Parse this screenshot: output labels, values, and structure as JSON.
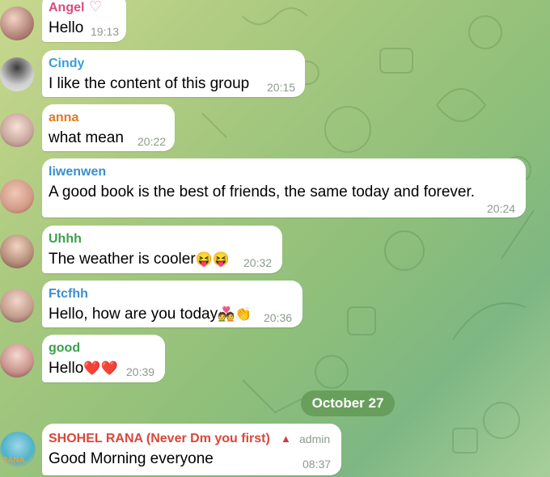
{
  "messages": [
    {
      "name": "Angel",
      "text": "Hello",
      "time": "19:13",
      "name_color": "#d64f7a",
      "badge": "♡"
    },
    {
      "name": "Cindy",
      "text": "I like the content of this group",
      "time": "20:15",
      "name_color": "#3a9fd6"
    },
    {
      "name": "anna",
      "text": "what  mean",
      "time": "20:22",
      "name_color": "#e07a1f"
    },
    {
      "name": "liwenwen",
      "text": "A good book is the best of friends, the same today and forever.",
      "time": "20:24",
      "name_color": "#3a8fd0"
    },
    {
      "name": "Uhhh",
      "text": "The weather is cooler",
      "emoji": "😝😝",
      "time": "20:32",
      "name_color": "#3aa04a"
    },
    {
      "name": "Ftcfhh",
      "text": "Hello, how are you today",
      "emoji": "💑👏",
      "time": "20:36",
      "name_color": "#3a8fd0"
    },
    {
      "name": "good",
      "text": "Hello",
      "emoji": "❤️❤️",
      "time": "20:39",
      "name_color": "#3aa04a"
    }
  ],
  "date_separator": "October 27",
  "last_message": {
    "name": "SHOHEL RANA (Never Dm you first)",
    "role": "admin",
    "text": "Good Morning everyone",
    "time": "08:37",
    "name_color": "#d9473a",
    "avatar_text": "RANA"
  }
}
